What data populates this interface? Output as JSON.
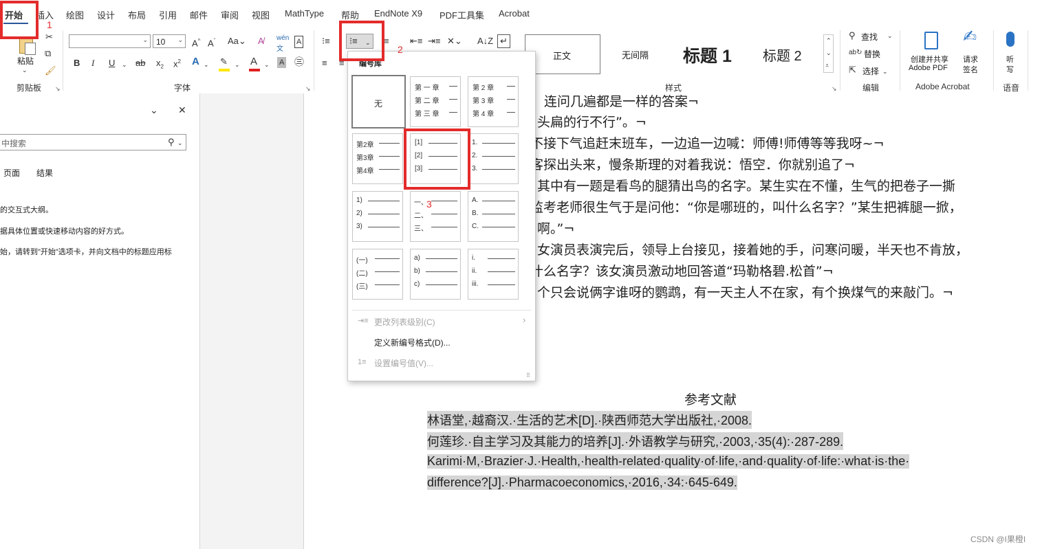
{
  "tabs": [
    "开始",
    "插入",
    "绘图",
    "设计",
    "布局",
    "引用",
    "邮件",
    "审阅",
    "视图",
    "MathType",
    "帮助",
    "EndNote X9",
    "PDF工具集",
    "Acrobat"
  ],
  "ribbon": {
    "clipboard": {
      "paste": "粘贴",
      "label": "剪贴板"
    },
    "font": {
      "label": "字体",
      "font_name": "",
      "font_size": "10"
    },
    "paragraph": {
      "label": ""
    },
    "styles": {
      "label": "样式",
      "items": [
        "正文",
        "无间隔",
        "标题 1",
        "标题 2"
      ]
    },
    "edit": {
      "label": "编辑",
      "find": "查找",
      "replace": "替换",
      "select": "选择"
    },
    "acrobat": {
      "label": "Adobe Acrobat",
      "create_line1": "创建并共享",
      "create_line2": "Adobe PDF",
      "request_line1": "请求",
      "request_line2": "签名"
    },
    "voice": {
      "label": "语音",
      "listen_line1": "听",
      "listen_line2": "写"
    }
  },
  "nav": {
    "search_placeholder": "中搜索",
    "tabs": [
      "页面",
      "结果"
    ],
    "hints": [
      "的交互式大纲。",
      "据具体位置或快速移动内容的好方式。",
      "始，请转到\"开始\"选项卡，并向文档中的标题应用标"
    ]
  },
  "dropdown": {
    "title": "编号库",
    "none": "无",
    "chapters_a": [
      "第 一 章",
      "第 二 章",
      "第 三 章"
    ],
    "chapters_b": [
      "第 2 章",
      "第 3 章",
      "第 4 章"
    ],
    "chapters_c": [
      "第2章",
      "第3章",
      "第4章"
    ],
    "bracket": [
      "[1]",
      "[2]",
      "[3]"
    ],
    "dot_num": [
      "1.",
      "2.",
      "3."
    ],
    "paren_num": [
      "1)",
      "2)",
      "3)"
    ],
    "chinese": [
      "一、",
      "二、",
      "三、"
    ],
    "upper": [
      "A.",
      "B.",
      "C."
    ],
    "paren_chinese": [
      "(一)",
      "(二)",
      "(三)"
    ],
    "lower_paren": [
      "a)",
      "b)",
      "c)"
    ],
    "roman": [
      "i.",
      "ii.",
      "iii."
    ],
    "change_level": "更改列表级别(C)",
    "define_new": "定义新编号格式(D)...",
    "set_value": "设置编号值(V)..."
  },
  "annotations": [
    "1",
    "2",
    "3"
  ],
  "document": {
    "lines": [
      "连问几遍都是一样的答案¬",
      "头扁的行不行”。¬",
      "不接下气追赶末班车，一边追一边喊：师傅!师傅等等我呀~¬",
      "客探出头来，慢条斯理的对着我说：悟空．你就别追了¬",
      "其中有一题是看鸟的腿猜出鸟的名字。某生实在不懂，生气的把卷子一撕",
      "监考老师很生气于是问他：“你是哪班的，叫什么名字？”某生把裤腿一掀，",
      "啊。”¬",
      "女演员表演完后，领导上台接见，接着她的手，问寒问暖，半天也不肯放，",
      "什么名字？该女演员激动地回答道“玛勒格碧.松首”¬",
      "个只会说俩字谁呀的鹦鹉，有一天主人不在家，有个换煤气的来敲门。¬"
    ],
    "ref_title": "参考文献",
    "refs": [
      "林语堂,·越裔汉.·生活的艺术[D].·陕西师范大学出版社,·2008.",
      "何莲珍.·自主学习及其能力的培养[J].·外语教学与研究,·2003,·35(4):·287-289.",
      "Karimi·M,·Brazier·J.·Health,·health-related·quality·of·life,·and·quality·of·life:·what·is·the·",
      "difference?[J].·Pharmacoeconomics,·2016,·34:·645-649."
    ]
  },
  "watermark": "CSDN @I果橙I"
}
